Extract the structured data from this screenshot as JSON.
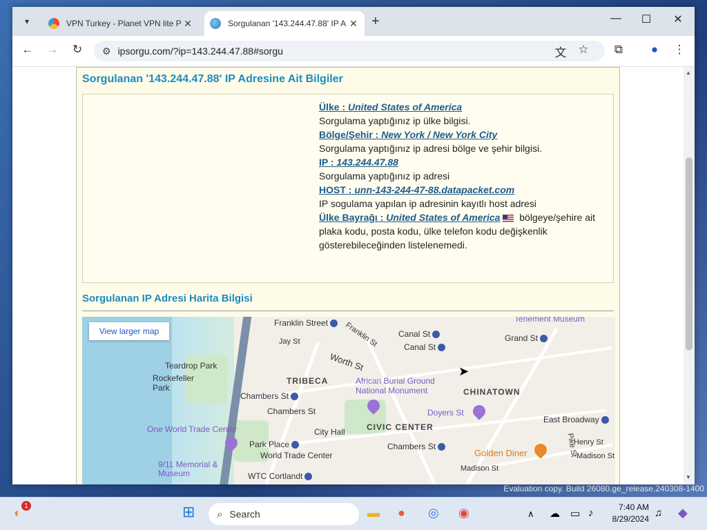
{
  "browser": {
    "tabs": [
      {
        "title": "VPN Turkey - Planet VPN lite Pr",
        "active": false
      },
      {
        "title": "Sorgulanan '143.244.47.88' IP A",
        "active": true
      }
    ],
    "new_tab_symbol": "+",
    "url": "ipsorgu.com/?ip=143.244.47.88#sorgu"
  },
  "page": {
    "heading": "Sorgulanan '143.244.47.88' IP Adresine Ait Bilgiler",
    "country_label": "Ülke : ",
    "country_value": "United States of America",
    "country_desc": "Sorgulama yaptığınız ip ülke bilgisi.",
    "region_label": "Bölge/Şehir : ",
    "region_value": "New York / New York City",
    "region_desc": "Sorgulama yaptığınız ip adresi bölge ve şehir bilgisi.",
    "ip_label": "IP : ",
    "ip_value": "143.244.47.88",
    "ip_desc": "Sorgulama yaptığınız ip adresi",
    "host_label": "HOST : ",
    "host_value": "unn-143-244-47-88.datapacket.com",
    "host_desc": "IP sogulama yapılan ip adresinin kayıtlı host adresi",
    "flag_label": "Ülke Bayrağı : ",
    "flag_value": "United States of America",
    "flag_desc": "bölgeye/şehire ait plaka kodu, posta kodu, ülke telefon kodu değişkenlik gösterebileceğinden listelenemedi.",
    "map_heading": "Sorgulanan IP Adresi Harita Bilgisi",
    "view_larger_map": "View larger map"
  },
  "map_labels": {
    "franklin_st": "Franklin Street",
    "franklin_st2": "Franklin St",
    "jay_st": "Jay St",
    "canal_st_1": "Canal St",
    "canal_st_2": "Canal St",
    "grand_st": "Grand St",
    "tenement": "Tenement Museum",
    "worth_st": "Worth St",
    "teardrop": "Teardrop Park",
    "rockefeller": "Rockefeller Park",
    "tribeca": "TRIBECA",
    "african": "African Burial Ground National Monument",
    "chinatown": "CHINATOWN",
    "chambers_1": "Chambers St",
    "chambers_2": "Chambers St",
    "chambers_3": "Chambers St",
    "doyers": "Doyers St",
    "civic": "CIVIC CENTER",
    "one_wtc": "One World Trade Center",
    "city_hall": "City Hall",
    "east_broadway": "East Broadway",
    "park_place": "Park Place",
    "wtc": "World Trade Center",
    "henry_st": "Henry St",
    "golden_diner": "Golden Diner",
    "madison_st_1": "Madison St",
    "madison_st_2": "Madison St",
    "pike_st": "Pike St",
    "memorial": "9/11 Memorial & Museum",
    "wtc_cortlandt": "WTC Cortlandt"
  },
  "system": {
    "watermark": "Evaluation copy. Build 26080.ge_release.240308-1400",
    "search_placeholder": "Search",
    "time": "7:40 AM",
    "date": "8/29/2024",
    "notification_count": "1"
  }
}
